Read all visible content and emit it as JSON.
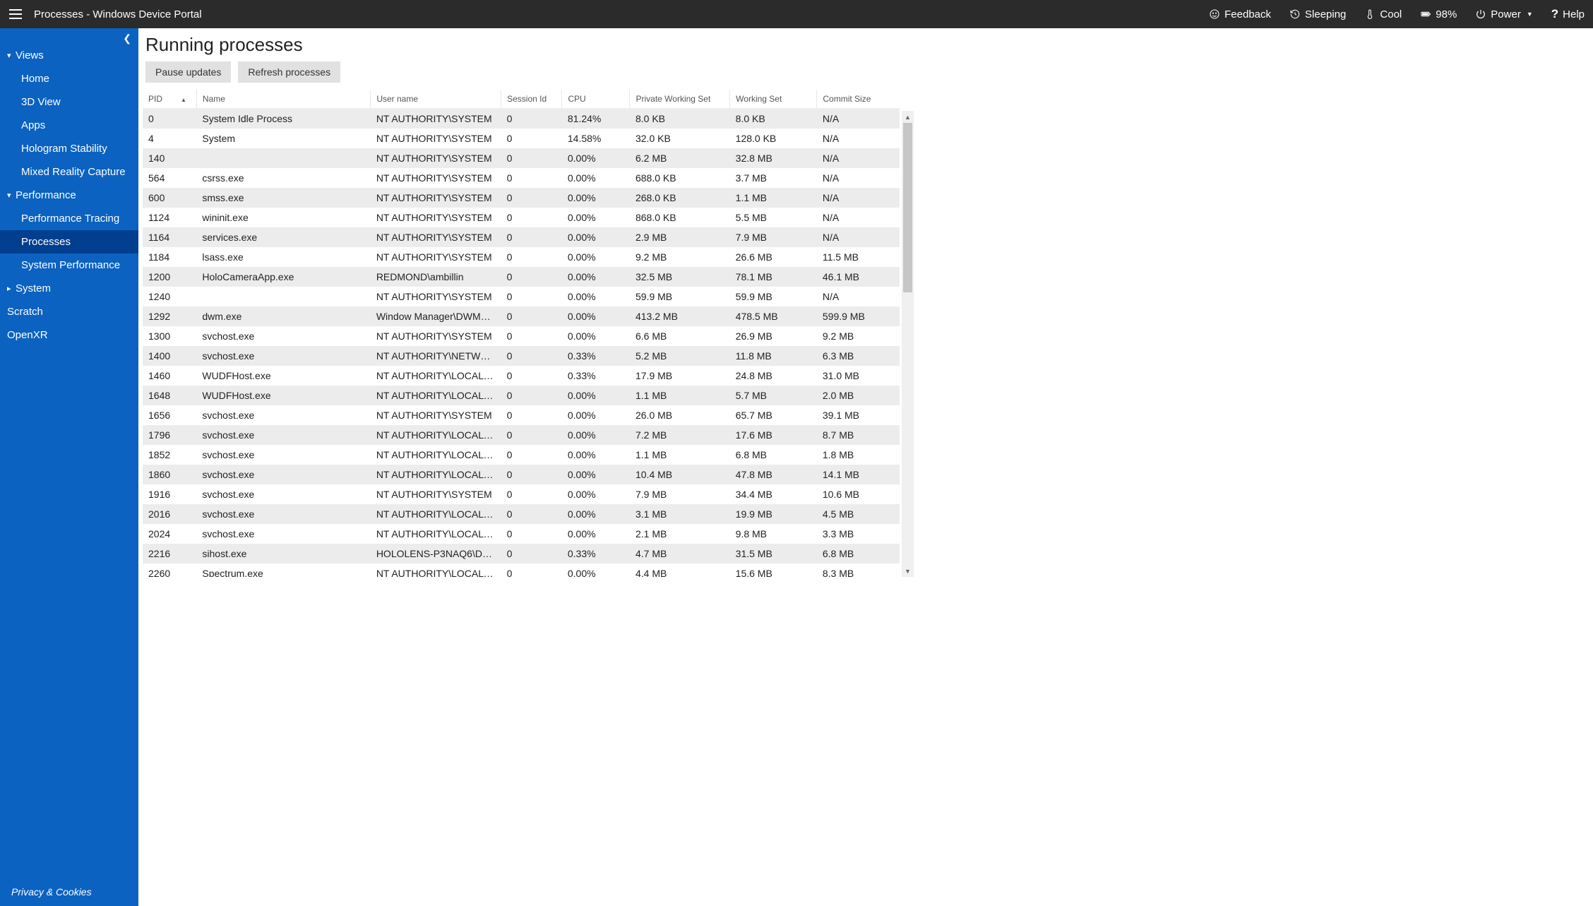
{
  "topbar": {
    "title": "Processes - Windows Device Portal",
    "feedback": "Feedback",
    "sleeping": "Sleeping",
    "cool": "Cool",
    "battery": "98%",
    "power": "Power",
    "help": "Help"
  },
  "sidebar": {
    "sections": [
      {
        "label": "Views",
        "expanded": true,
        "items": [
          {
            "label": "Home"
          },
          {
            "label": "3D View"
          },
          {
            "label": "Apps"
          },
          {
            "label": "Hologram Stability"
          },
          {
            "label": "Mixed Reality Capture"
          }
        ]
      },
      {
        "label": "Performance",
        "expanded": true,
        "items": [
          {
            "label": "Performance Tracing"
          },
          {
            "label": "Processes",
            "active": true
          },
          {
            "label": "System Performance"
          }
        ]
      },
      {
        "label": "System",
        "expanded": false,
        "items": []
      }
    ],
    "extras": [
      {
        "label": "Scratch"
      },
      {
        "label": "OpenXR"
      }
    ],
    "footer": "Privacy & Cookies"
  },
  "page": {
    "title": "Running processes",
    "buttons": {
      "pause": "Pause updates",
      "refresh": "Refresh processes"
    }
  },
  "table": {
    "columns": [
      "PID",
      "Name",
      "User name",
      "Session Id",
      "CPU",
      "Private Working Set",
      "Working Set",
      "Commit Size"
    ],
    "sort_col": 0,
    "sort_dir": "asc",
    "rows": [
      {
        "pid": "0",
        "name": "System Idle Process",
        "user": "NT AUTHORITY\\SYSTEM",
        "sess": "0",
        "cpu": "81.24%",
        "pws": "8.0 KB",
        "ws": "8.0 KB",
        "commit": "N/A"
      },
      {
        "pid": "4",
        "name": "System",
        "user": "NT AUTHORITY\\SYSTEM",
        "sess": "0",
        "cpu": "14.58%",
        "pws": "32.0 KB",
        "ws": "128.0 KB",
        "commit": "N/A"
      },
      {
        "pid": "140",
        "name": "",
        "user": "NT AUTHORITY\\SYSTEM",
        "sess": "0",
        "cpu": "0.00%",
        "pws": "6.2 MB",
        "ws": "32.8 MB",
        "commit": "N/A"
      },
      {
        "pid": "564",
        "name": "csrss.exe",
        "user": "NT AUTHORITY\\SYSTEM",
        "sess": "0",
        "cpu": "0.00%",
        "pws": "688.0 KB",
        "ws": "3.7 MB",
        "commit": "N/A"
      },
      {
        "pid": "600",
        "name": "smss.exe",
        "user": "NT AUTHORITY\\SYSTEM",
        "sess": "0",
        "cpu": "0.00%",
        "pws": "268.0 KB",
        "ws": "1.1 MB",
        "commit": "N/A"
      },
      {
        "pid": "1124",
        "name": "wininit.exe",
        "user": "NT AUTHORITY\\SYSTEM",
        "sess": "0",
        "cpu": "0.00%",
        "pws": "868.0 KB",
        "ws": "5.5 MB",
        "commit": "N/A"
      },
      {
        "pid": "1164",
        "name": "services.exe",
        "user": "NT AUTHORITY\\SYSTEM",
        "sess": "0",
        "cpu": "0.00%",
        "pws": "2.9 MB",
        "ws": "7.9 MB",
        "commit": "N/A"
      },
      {
        "pid": "1184",
        "name": "lsass.exe",
        "user": "NT AUTHORITY\\SYSTEM",
        "sess": "0",
        "cpu": "0.00%",
        "pws": "9.2 MB",
        "ws": "26.6 MB",
        "commit": "11.5 MB"
      },
      {
        "pid": "1200",
        "name": "HoloCameraApp.exe",
        "user": "REDMOND\\ambillin",
        "sess": "0",
        "cpu": "0.00%",
        "pws": "32.5 MB",
        "ws": "78.1 MB",
        "commit": "46.1 MB"
      },
      {
        "pid": "1240",
        "name": "",
        "user": "NT AUTHORITY\\SYSTEM",
        "sess": "0",
        "cpu": "0.00%",
        "pws": "59.9 MB",
        "ws": "59.9 MB",
        "commit": "N/A"
      },
      {
        "pid": "1292",
        "name": "dwm.exe",
        "user": "Window Manager\\DWM…",
        "sess": "0",
        "cpu": "0.00%",
        "pws": "413.2 MB",
        "ws": "478.5 MB",
        "commit": "599.9 MB"
      },
      {
        "pid": "1300",
        "name": "svchost.exe",
        "user": "NT AUTHORITY\\SYSTEM",
        "sess": "0",
        "cpu": "0.00%",
        "pws": "6.6 MB",
        "ws": "26.9 MB",
        "commit": "9.2 MB"
      },
      {
        "pid": "1400",
        "name": "svchost.exe",
        "user": "NT AUTHORITY\\NETWO…",
        "sess": "0",
        "cpu": "0.33%",
        "pws": "5.2 MB",
        "ws": "11.8 MB",
        "commit": "6.3 MB"
      },
      {
        "pid": "1460",
        "name": "WUDFHost.exe",
        "user": "NT AUTHORITY\\LOCAL …",
        "sess": "0",
        "cpu": "0.33%",
        "pws": "17.9 MB",
        "ws": "24.8 MB",
        "commit": "31.0 MB"
      },
      {
        "pid": "1648",
        "name": "WUDFHost.exe",
        "user": "NT AUTHORITY\\LOCAL …",
        "sess": "0",
        "cpu": "0.00%",
        "pws": "1.1 MB",
        "ws": "5.7 MB",
        "commit": "2.0 MB"
      },
      {
        "pid": "1656",
        "name": "svchost.exe",
        "user": "NT AUTHORITY\\SYSTEM",
        "sess": "0",
        "cpu": "0.00%",
        "pws": "26.0 MB",
        "ws": "65.7 MB",
        "commit": "39.1 MB"
      },
      {
        "pid": "1796",
        "name": "svchost.exe",
        "user": "NT AUTHORITY\\LOCAL …",
        "sess": "0",
        "cpu": "0.00%",
        "pws": "7.2 MB",
        "ws": "17.6 MB",
        "commit": "8.7 MB"
      },
      {
        "pid": "1852",
        "name": "svchost.exe",
        "user": "NT AUTHORITY\\LOCAL …",
        "sess": "0",
        "cpu": "0.00%",
        "pws": "1.1 MB",
        "ws": "6.8 MB",
        "commit": "1.8 MB"
      },
      {
        "pid": "1860",
        "name": "svchost.exe",
        "user": "NT AUTHORITY\\LOCAL …",
        "sess": "0",
        "cpu": "0.00%",
        "pws": "10.4 MB",
        "ws": "47.8 MB",
        "commit": "14.1 MB"
      },
      {
        "pid": "1916",
        "name": "svchost.exe",
        "user": "NT AUTHORITY\\SYSTEM",
        "sess": "0",
        "cpu": "0.00%",
        "pws": "7.9 MB",
        "ws": "34.4 MB",
        "commit": "10.6 MB"
      },
      {
        "pid": "2016",
        "name": "svchost.exe",
        "user": "NT AUTHORITY\\LOCAL …",
        "sess": "0",
        "cpu": "0.00%",
        "pws": "3.1 MB",
        "ws": "19.9 MB",
        "commit": "4.5 MB"
      },
      {
        "pid": "2024",
        "name": "svchost.exe",
        "user": "NT AUTHORITY\\LOCAL …",
        "sess": "0",
        "cpu": "0.00%",
        "pws": "2.1 MB",
        "ws": "9.8 MB",
        "commit": "3.3 MB"
      },
      {
        "pid": "2216",
        "name": "sihost.exe",
        "user": "HOLOLENS-P3NAQ6\\De…",
        "sess": "0",
        "cpu": "0.33%",
        "pws": "4.7 MB",
        "ws": "31.5 MB",
        "commit": "6.8 MB"
      },
      {
        "pid": "2260",
        "name": "Spectrum.exe",
        "user": "NT AUTHORITY\\LOCAL …",
        "sess": "0",
        "cpu": "0.00%",
        "pws": "4.4 MB",
        "ws": "15.6 MB",
        "commit": "8.3 MB"
      }
    ]
  }
}
